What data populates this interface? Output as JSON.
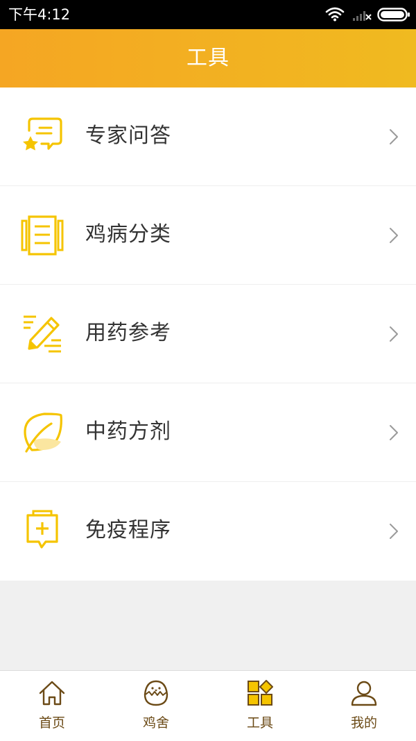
{
  "status_bar": {
    "time": "下午4:12"
  },
  "header": {
    "title": "工具"
  },
  "menu": {
    "items": [
      {
        "label": "专家问答",
        "icon": "expert-qa-icon"
      },
      {
        "label": "鸡病分类",
        "icon": "document-list-icon"
      },
      {
        "label": "用药参考",
        "icon": "edit-note-icon"
      },
      {
        "label": "中药方剂",
        "icon": "leaf-icon"
      },
      {
        "label": "免疫程序",
        "icon": "medical-clipboard-icon"
      }
    ]
  },
  "bottom_nav": {
    "items": [
      {
        "label": "首页",
        "icon": "home-icon"
      },
      {
        "label": "鸡舍",
        "icon": "chick-egg-icon"
      },
      {
        "label": "工具",
        "icon": "tools-grid-icon",
        "active": true
      },
      {
        "label": "我的",
        "icon": "user-icon"
      }
    ]
  },
  "colors": {
    "accent": "#f5a623",
    "accent_light": "#f0ba20",
    "icon_yellow": "#f5c400",
    "nav_text": "#6b4a16",
    "background": "#f0f0f0"
  }
}
